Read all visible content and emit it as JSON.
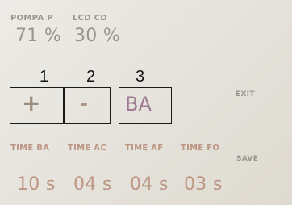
{
  "status": {
    "pompa_label": "POMPA P",
    "pompa_value": "71 %",
    "lcd_label": "LCD CD",
    "lcd_value": "30 %"
  },
  "buttons": {
    "plus": {
      "number": "1",
      "label": "+"
    },
    "minus": {
      "number": "2",
      "label": "-"
    },
    "mode": {
      "number": "3",
      "label": "BA"
    },
    "exit_label": "EXIT",
    "save_label": "SAVE"
  },
  "timers": [
    {
      "label": "TIME BA",
      "value": "10 s"
    },
    {
      "label": "TIME AC",
      "value": "04 s"
    },
    {
      "label": "TIME AF",
      "value": "04 s"
    },
    {
      "label": "TIME FO",
      "value": "03 s"
    }
  ],
  "colors": {
    "status_text": "#9a958d",
    "timer_text": "#bc9583",
    "mode_text": "#9b7a92",
    "outline": "#1a1a1a"
  }
}
